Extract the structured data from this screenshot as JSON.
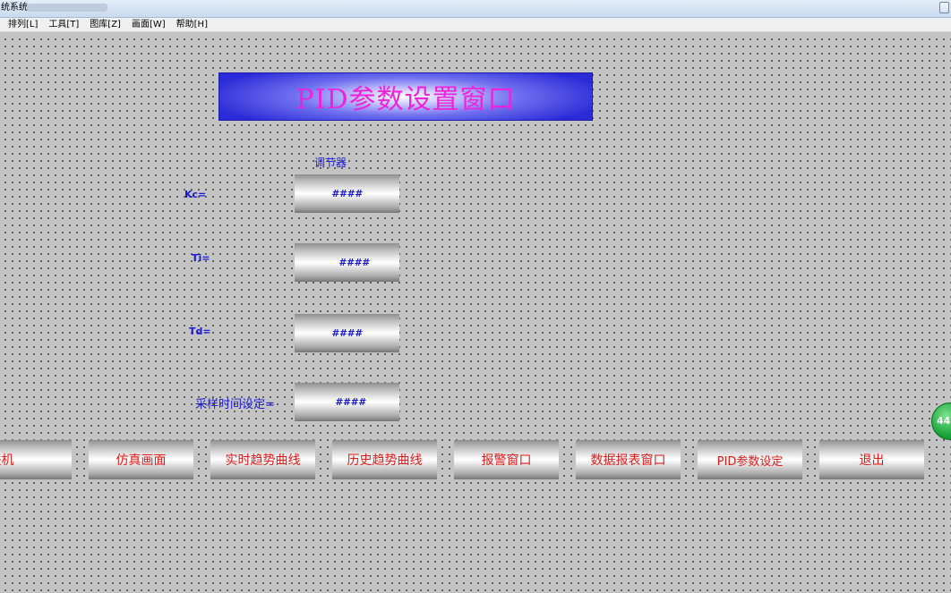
{
  "window": {
    "title": "统系统"
  },
  "menu": [
    {
      "label": "排列[L]"
    },
    {
      "label": "工具[T]"
    },
    {
      "label": "图库[Z]"
    },
    {
      "label": "画面[W]"
    },
    {
      "label": "帮助[H]"
    }
  ],
  "banner": {
    "title": "PID参数设置窗口"
  },
  "controller": {
    "heading": "调节器",
    "fields": [
      {
        "label": "Kc=",
        "value": "####"
      },
      {
        "label": "Ti=",
        "value": "####"
      },
      {
        "label": "Td=",
        "value": "####"
      },
      {
        "label": "采样时间设定=",
        "value": "####"
      }
    ]
  },
  "nav_buttons": [
    {
      "label": "联机"
    },
    {
      "label": "仿真画面"
    },
    {
      "label": "实时趋势曲线"
    },
    {
      "label": "历史趋势曲线"
    },
    {
      "label": "报警窗口"
    },
    {
      "label": "数据报表窗口"
    },
    {
      "label": "PID参数设定"
    },
    {
      "label": "退出"
    }
  ],
  "badge": {
    "value": "44"
  },
  "colors": {
    "canvas": "#c4c4c4",
    "label_blue": "#1a1ad8",
    "button_text_red": "#e21a1a",
    "banner_title_magenta": "#ee22dd",
    "banner_blue": "#2a2ad8"
  }
}
